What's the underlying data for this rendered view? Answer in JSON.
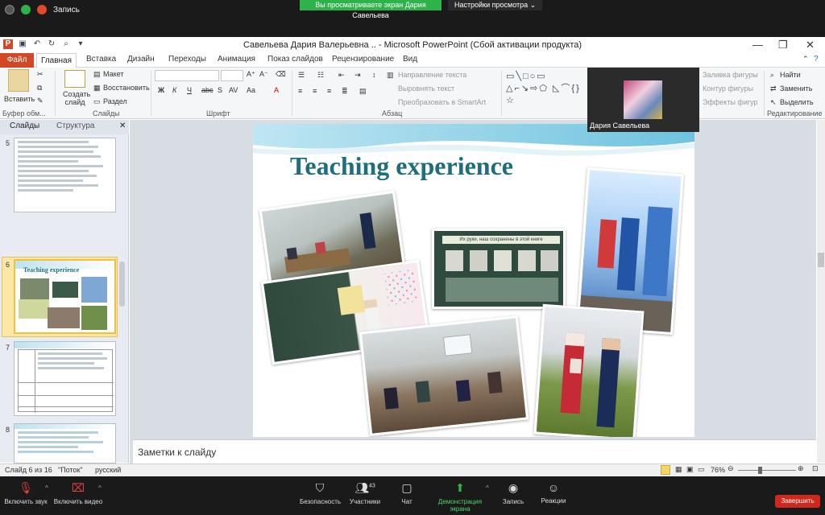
{
  "zoom_top": {
    "record_label": "Запись",
    "share_banner": "Вы просматриваете экран Дария Савельева",
    "view_settings": "Настройки просмотра"
  },
  "window": {
    "title": "Савельева Дария Валерьевна .. - Microsoft PowerPoint (Сбой активации продукта)"
  },
  "tabs": [
    "Файл",
    "Главная",
    "Вставка",
    "Дизайн",
    "Переходы",
    "Анимация",
    "Показ слайдов",
    "Рецензирование",
    "Вид"
  ],
  "ribbon": {
    "paste": "Вставить",
    "clipboard_group": "Буфер обм...",
    "create_slide": "Создать слайд",
    "layout": "Макет",
    "reset": "Восстановить",
    "section": "Раздел",
    "slides_group": "Слайды",
    "font_group": "Шрифт",
    "paragraph_group": "Абзац",
    "text_direction": "Направление текста",
    "align_text": "Выровнять текст",
    "convert_smartart": "Преобразовать в SmartArt",
    "shape_fill": "Заливка фигуры",
    "shape_outline": "Контур фигуры",
    "shape_effects": "Эффекты фигур",
    "find": "Найти",
    "replace": "Заменить",
    "select": "Выделить",
    "editing_group": "Редактирование",
    "bold": "Ж",
    "italic": "К",
    "underline": "Ч",
    "strike": "abc",
    "shadow": "S",
    "spacing": "AV",
    "case": "Aa"
  },
  "panel": {
    "tab_slides": "Слайды",
    "tab_outline": "Структура",
    "slide_numbers": [
      "5",
      "6",
      "7",
      "8"
    ],
    "thumb6_title": "Teaching experience"
  },
  "slide": {
    "title": "Teaching experience",
    "poster_text": "Их руки, наш сохранены в этой книге"
  },
  "notes": {
    "placeholder": "Заметки к слайду"
  },
  "participant": {
    "name": "Дария Савельева"
  },
  "status": {
    "slide_info": "Слайд 6 из 16",
    "theme": "\"Поток\"",
    "language": "русский",
    "zoom": "76%"
  },
  "zoom_bottom": {
    "mute": "Включить звук",
    "video": "Включить видео",
    "security": "Безопасность",
    "participants": "Участники",
    "participants_count": "43",
    "chat": "Чат",
    "share_screen": "Демонстрация экрана",
    "record": "Запись",
    "reactions": "Реакции",
    "end": "Завершить"
  },
  "colors": {
    "share_green": "#2db34a",
    "file_tab": "#d24726",
    "end_red": "#d0281f",
    "title_teal": "#1e6e7e"
  }
}
